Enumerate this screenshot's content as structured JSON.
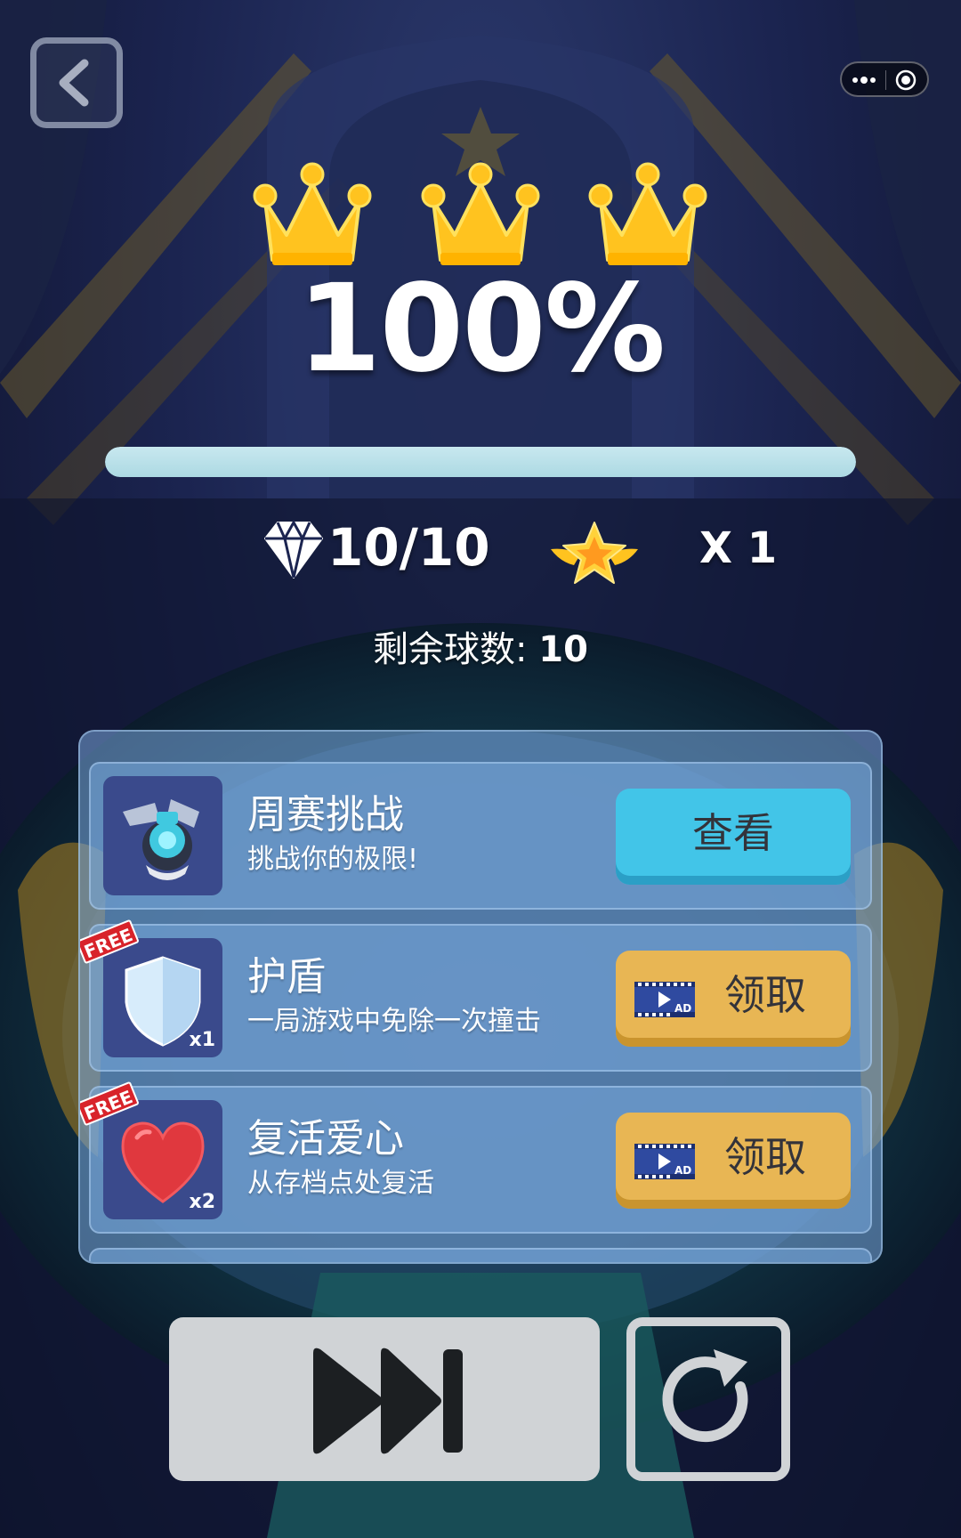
{
  "game": {
    "crowns_earned": 3,
    "percent_text": "100%",
    "progress": 1.0,
    "gems_text": "10/10",
    "star_multiplier": "X 1",
    "balls_label": "剩余球数: ",
    "balls_value": "10"
  },
  "rewards": [
    {
      "title": "周赛挑战",
      "subtitle": "挑战你的极限!",
      "action": "查看",
      "icon": "robot-icon"
    },
    {
      "title": "护盾",
      "subtitle": "一局游戏中免除一次撞击",
      "action": "领取",
      "badge": "FREE",
      "qty": "x1",
      "icon": "shield-icon"
    },
    {
      "title": "复活爱心",
      "subtitle": "从存档点处复活",
      "action": "领取",
      "badge": "FREE",
      "qty": "x2",
      "icon": "heart-icon"
    }
  ],
  "colors": {
    "view_button": "#42c5e8",
    "claim_button": "#e8b654",
    "crown": "#ffc31f",
    "progress_fill": "#acd9e3"
  }
}
